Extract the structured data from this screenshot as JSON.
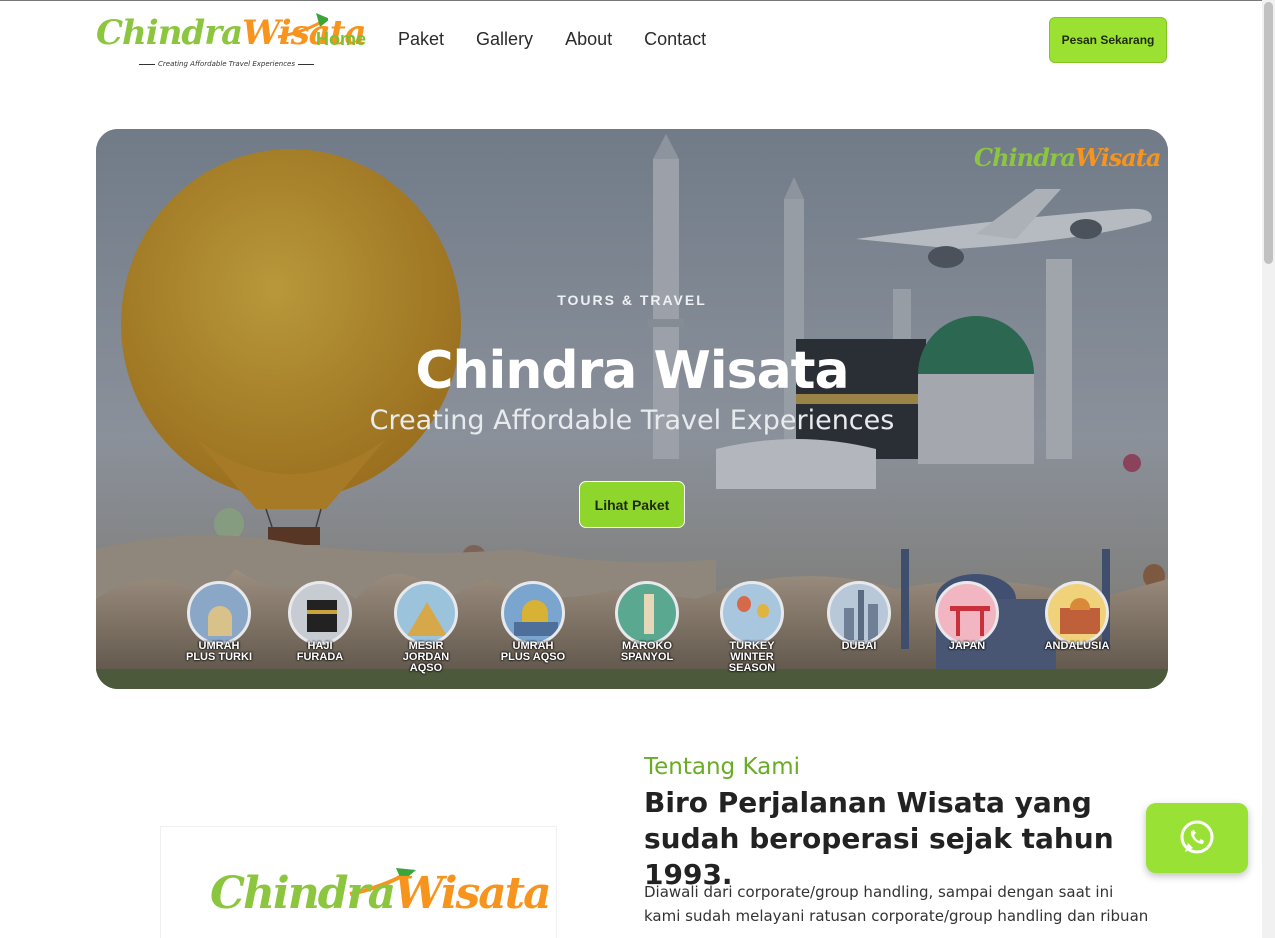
{
  "brand": {
    "name_part1": "Chindra",
    "name_part2": "Wisata",
    "tagline": "Creating Affordable Travel Experiences",
    "primary_color": "#8cc63f",
    "accent_color": "#f7941d"
  },
  "nav": {
    "items": [
      {
        "label": "Home",
        "active": true
      },
      {
        "label": "Paket",
        "active": false
      },
      {
        "label": "Gallery",
        "active": false
      },
      {
        "label": "About",
        "active": false
      },
      {
        "label": "Contact",
        "active": false
      }
    ],
    "cta_label": "Pesan Sekarang"
  },
  "hero": {
    "kicker": "TOURS & TRAVEL",
    "title": "Chindra Wisata",
    "subtitle": "Creating Affordable Travel Experiences",
    "button_label": "Lihat Paket",
    "destinations": [
      {
        "line1": "UMRAH",
        "line2": "PLUS TURKI",
        "line3": ""
      },
      {
        "line1": "HAJI",
        "line2": "FURADA",
        "line3": ""
      },
      {
        "line1": "MESIR",
        "line2": "JORDAN",
        "line3": "AQSO"
      },
      {
        "line1": "UMRAH",
        "line2": "PLUS AQSO",
        "line3": ""
      },
      {
        "line1": "MAROKO",
        "line2": "SPANYOL",
        "line3": ""
      },
      {
        "line1": "TURKEY",
        "line2": "WINTER",
        "line3": "SEASON"
      },
      {
        "line1": "DUBAI",
        "line2": "",
        "line3": ""
      },
      {
        "line1": "JAPAN",
        "line2": "",
        "line3": ""
      },
      {
        "line1": "ANDALUSIA",
        "line2": "",
        "line3": ""
      }
    ]
  },
  "about": {
    "kicker": "Tentang Kami",
    "title": "Biro Perjalanan Wisata yang sudah beroperasi sejak tahun 1993.",
    "body": "Diawali dari corporate/group handling, sampai dengan saat ini kami sudah melayani ratusan corporate/group handling dan ribuan"
  },
  "whatsapp": {
    "icon": "whatsapp-icon"
  }
}
